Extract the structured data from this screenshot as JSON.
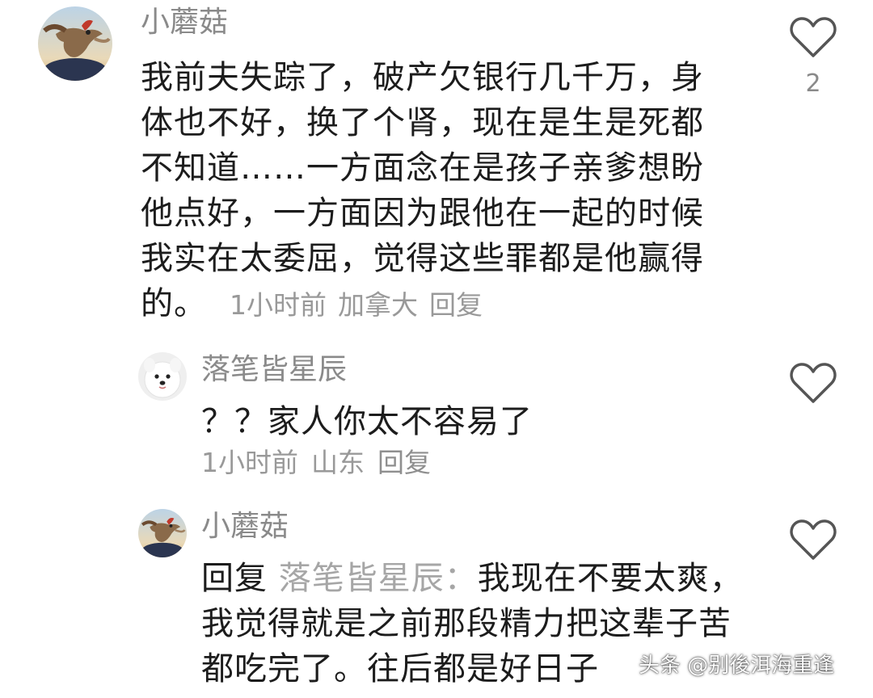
{
  "comments": [
    {
      "username": "小蘑菇",
      "text": "我前夫失踪了，破产欠银行几千万，身体也不好，换了个肾，现在是生是死都不知道……一方面念在是孩子亲爹想盼他点好，一方面因为跟他在一起的时候我实在太委屈，觉得这些罪都是他赢得的。",
      "time": "1小时前",
      "location": "加拿大",
      "reply_label": "回复",
      "like_count": "2",
      "avatar_icon": "rooster-photo-avatar"
    },
    {
      "username": "落笔皆星辰",
      "text": "？？家人你太不容易了",
      "time": "1小时前",
      "location": "山东",
      "reply_label": "回复",
      "avatar_icon": "samoyed-dog-avatar"
    },
    {
      "username": "小蘑菇",
      "reply_prefix": "回复",
      "reply_to": "落笔皆星辰：",
      "text": "我现在不要太爽，我觉得就是之前那段精力把这辈子苦都吃完了。往后都是好日子",
      "avatar_icon": "rooster-photo-avatar"
    }
  ],
  "watermark": "头条 @别後洱海重逢",
  "colors": {
    "username": "#8a8a8a",
    "text": "#1c1c1c",
    "meta": "#999999",
    "like_outline": "#555555"
  }
}
